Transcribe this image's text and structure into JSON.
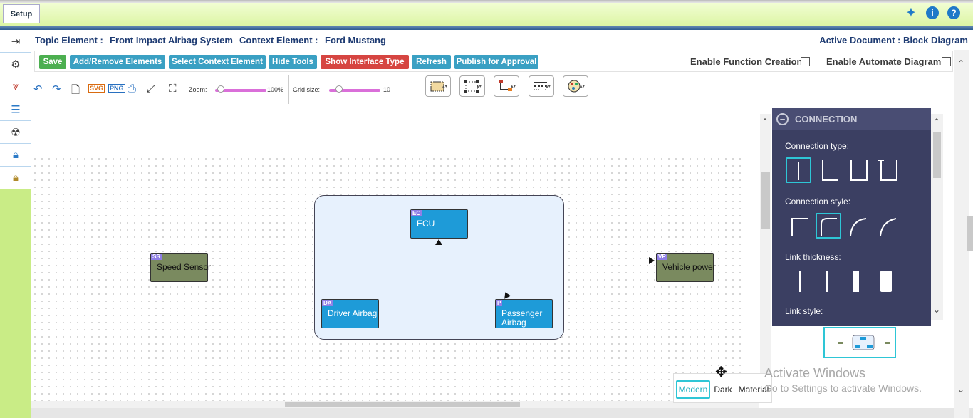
{
  "app": {
    "tab_label": "Setup"
  },
  "header": {
    "topic_label": "Topic Element :",
    "topic_value": "Front Impact Airbag System",
    "context_label": "Context Element :",
    "context_value": "Ford Mustang",
    "active_document": "Active Document : Block Diagram"
  },
  "toolbar": {
    "buttons": [
      {
        "label": "Save",
        "color": "#4caf50"
      },
      {
        "label": "Add/Remove Elements",
        "color": "#3aa0c3"
      },
      {
        "label": "Select Context Element",
        "color": "#3aa0c3"
      },
      {
        "label": "Hide Tools",
        "color": "#3aa0c3"
      },
      {
        "label": "Show Interface Type",
        "color": "#d64541"
      },
      {
        "label": "Refresh",
        "color": "#3aa0c3"
      },
      {
        "label": "Publish for Approval",
        "color": "#3aa0c3"
      }
    ],
    "enable_function_creation": "Enable Function Creation",
    "enable_automate_diagram": "Enable Automate Diagram"
  },
  "editor": {
    "zoom_label": "Zoom:",
    "zoom_value": "100%",
    "zoom_fraction": 0.05,
    "grid_label": "Grid size:",
    "grid_value": "10",
    "grid_fraction": 0.2
  },
  "diagram": {
    "nodes": [
      {
        "badge": "SS",
        "label": "Speed Sensor"
      },
      {
        "badge": "EC",
        "label": "ECU"
      },
      {
        "badge": "DA",
        "label": "Driver Airbag"
      },
      {
        "badge": "P",
        "label": "Passenger Airbag"
      },
      {
        "badge": "VP",
        "label": "Vehicle power"
      }
    ]
  },
  "panel": {
    "title": "CONNECTION",
    "connection_type": "Connection type:",
    "connection_style": "Connection style:",
    "link_thickness": "Link thickness:",
    "link_style": "Link style:"
  },
  "themes": {
    "modern": "Modern",
    "dark": "Dark",
    "material": "Material"
  },
  "watermark": {
    "line1": "Activate Windows",
    "line2": "Go to Settings to activate Windows."
  },
  "colors": {
    "accent": "#2ec6d6",
    "node_blue": "#1e9bd8",
    "node_green": "#7a8a5f",
    "panel_bg": "#3b3f62"
  }
}
